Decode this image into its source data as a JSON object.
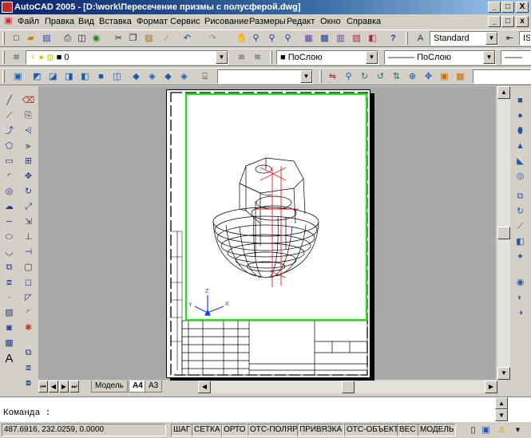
{
  "window": {
    "title": "AutoCAD 2005 - [D:\\work\\Пересечение призмы с полусферой.dwg]",
    "min": "_",
    "restore": "□",
    "close": "X"
  },
  "menu": [
    "Файл",
    "Правка",
    "Вид",
    "Вставка",
    "Формат",
    "Сервис",
    "Рисование",
    "Размеры",
    "Редакт",
    "Окно",
    "Справка"
  ],
  "toolbar": {
    "text_style": "Standard",
    "text_style_2": "IS"
  },
  "layers": {
    "current_layer": "0"
  },
  "properties": {
    "color": "ПоСлою",
    "linetype": "ПоСлою"
  },
  "view_combo": {
    "value": ""
  },
  "tabs": [
    "Модель",
    "A4",
    "A3"
  ],
  "command": {
    "prompt": "Команда :"
  },
  "status": {
    "coords": "487.6916,  232.0259, 0.0000",
    "toggles": [
      "ШАГ",
      "СЕТКА",
      "ОРТО",
      "ОТС-ПОЛЯР",
      "ПРИВЯЗКА",
      "ОТС-ОБЪЕКТ",
      "ВЕС",
      "МОДЕЛЬ"
    ]
  },
  "colors": {
    "viewport_border": "#22dd22",
    "axis_red": "#dd2222",
    "ucs_blue": "#1a3aff",
    "canvas_bg": "#a9a9a9"
  }
}
